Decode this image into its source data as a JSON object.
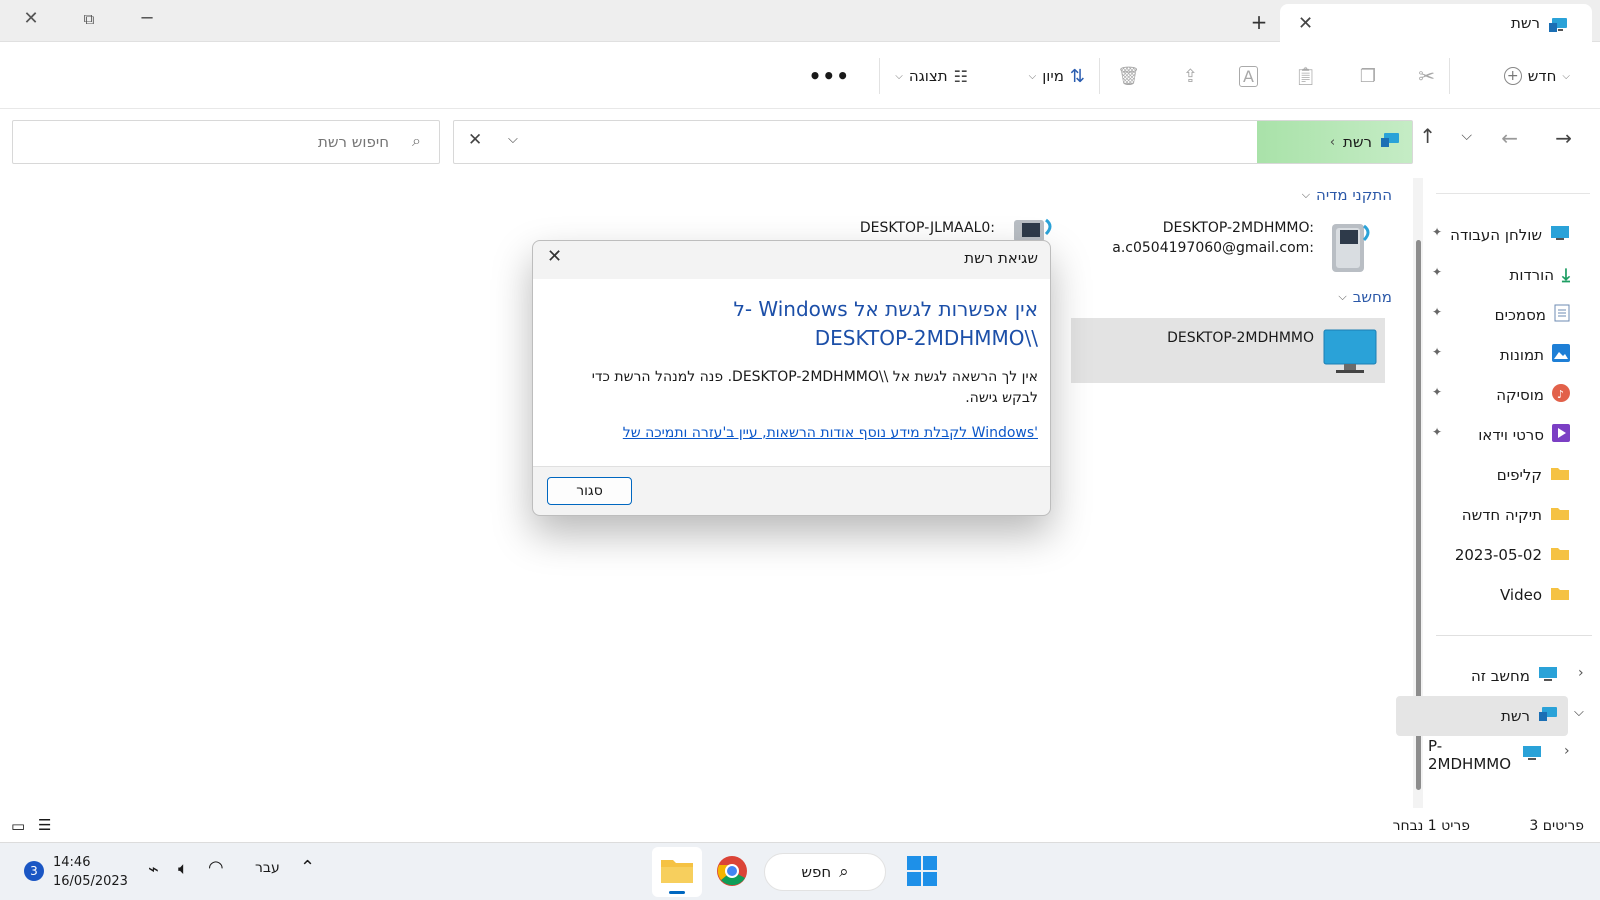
{
  "window": {
    "tab_title": "רשת",
    "new_tab_icon": "plus-icon",
    "tab_close_icon": "close-icon"
  },
  "toolbar": {
    "new_label": "חדש",
    "sort_label": "מיון",
    "view_label": "תצוגה",
    "more_icon": "more-icon"
  },
  "address": {
    "path_label": "רשת",
    "search_placeholder": "חיפוש רשת"
  },
  "sidebar": {
    "quick_access": [
      {
        "label": "שולחן העבודה",
        "icon": "desktop-icon",
        "pinned": true
      },
      {
        "label": "הורדות",
        "icon": "download-icon",
        "pinned": true
      },
      {
        "label": "מסמכים",
        "icon": "documents-icon",
        "pinned": true
      },
      {
        "label": "תמונות",
        "icon": "pictures-icon",
        "pinned": true
      },
      {
        "label": "מוסיקה",
        "icon": "music-icon",
        "pinned": true
      },
      {
        "label": "סרטי וידאו",
        "icon": "videos-icon",
        "pinned": true
      },
      {
        "label": "קליפים",
        "icon": "folder-icon",
        "pinned": false
      },
      {
        "label": "תיקיה חדשה",
        "icon": "folder-icon",
        "pinned": false
      },
      {
        "label": "2023-05-02",
        "icon": "folder-icon",
        "pinned": false
      },
      {
        "label": "Video",
        "icon": "folder-icon",
        "pinned": false
      }
    ],
    "this_pc": "מחשב זה",
    "network": "רשת",
    "network_child": "P-2MDHMMO"
  },
  "content": {
    "media_group": "התקני מדיה",
    "computer_group": "מחשב",
    "media_item_1_line1": "DESKTOP-2MDHMMO:",
    "media_item_1_line2": "a.c0504197060@gmail.com:",
    "media_item_2": "DESKTOP-JLMAAL0:",
    "computer_item": "DESKTOP-2MDHMMO"
  },
  "dialog": {
    "title": "שגיאת רשת",
    "heading_line1": "ל- Windows אין אפשרות לגשת אל",
    "heading_line2": "DESKTOP-2MDHMMO\\\\",
    "message": "אין לך הרשאה לגשת אל \\\\DESKTOP-2MDHMMO. פנה למנהל הרשת כדי לבקש גישה.",
    "link": "לקבלת מידע נוסף אודות הרשאות, עיין ב'עזרה ותמיכה של Windows'",
    "close_button": "סגור"
  },
  "status": {
    "items_count": "3 פריטים",
    "selected": "פריט 1 נבחר"
  },
  "taskbar": {
    "search_label": "חפש",
    "time": "14:46",
    "date": "16/05/2023",
    "language": "עבר",
    "notification_count": "3"
  },
  "colors": {
    "accent": "#0067c0",
    "heading_blue": "#1c4fa8",
    "link_blue": "#0b57c9",
    "address_highlight": "#b8e8b8",
    "folder_yellow": "#f5c243"
  }
}
